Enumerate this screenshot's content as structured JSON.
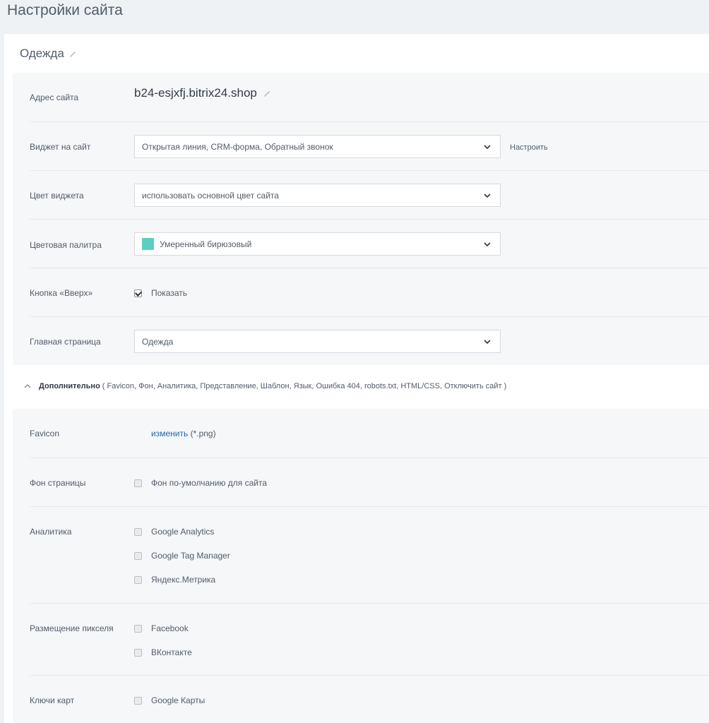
{
  "page": {
    "title": "Настройки сайта"
  },
  "site": {
    "name": "Одежда"
  },
  "settings": {
    "address": {
      "label": "Адрес сайта",
      "value": "b24-esjxfj.bitrix24.shop"
    },
    "widget": {
      "label": "Виджет на сайт",
      "value": "Открытая линия, CRM-форма, Обратный звонок",
      "setup_link": "Настроить"
    },
    "widget_color": {
      "label": "Цвет виджета",
      "value": "использовать основной цвет сайта"
    },
    "palette": {
      "label": "Цветовая палитра",
      "value": "Умеренный бирюзовый",
      "swatch_color": "#5dcfc0"
    },
    "up_button": {
      "label": "Кнопка «Вверх»",
      "option": "Показать",
      "checked": true
    },
    "home_page": {
      "label": "Главная страница",
      "value": "Одежда"
    }
  },
  "advanced": {
    "title": "Дополнительно",
    "items": "( Favicon,  Фон,  Аналитика,  Представление,  Шаблон,  Язык,  Ошибка 404,  robots.txt,  HTML/CSS,  Отключить сайт )"
  },
  "extra": {
    "favicon": {
      "label": "Favicon",
      "link": "изменить",
      "hint": "(*.png)"
    },
    "background": {
      "label": "Фон страницы",
      "option": "Фон по-умолчанию для сайта"
    },
    "analytics": {
      "label": "Аналитика",
      "options": [
        "Google Analytics",
        "Google Tag Manager",
        "Яндекс.Метрика"
      ]
    },
    "pixel": {
      "label": "Размещение пикселя",
      "options": [
        "Facebook",
        "ВКонтакте"
      ]
    },
    "maps": {
      "label": "Ключи карт",
      "options": [
        "Google Карты"
      ]
    }
  }
}
